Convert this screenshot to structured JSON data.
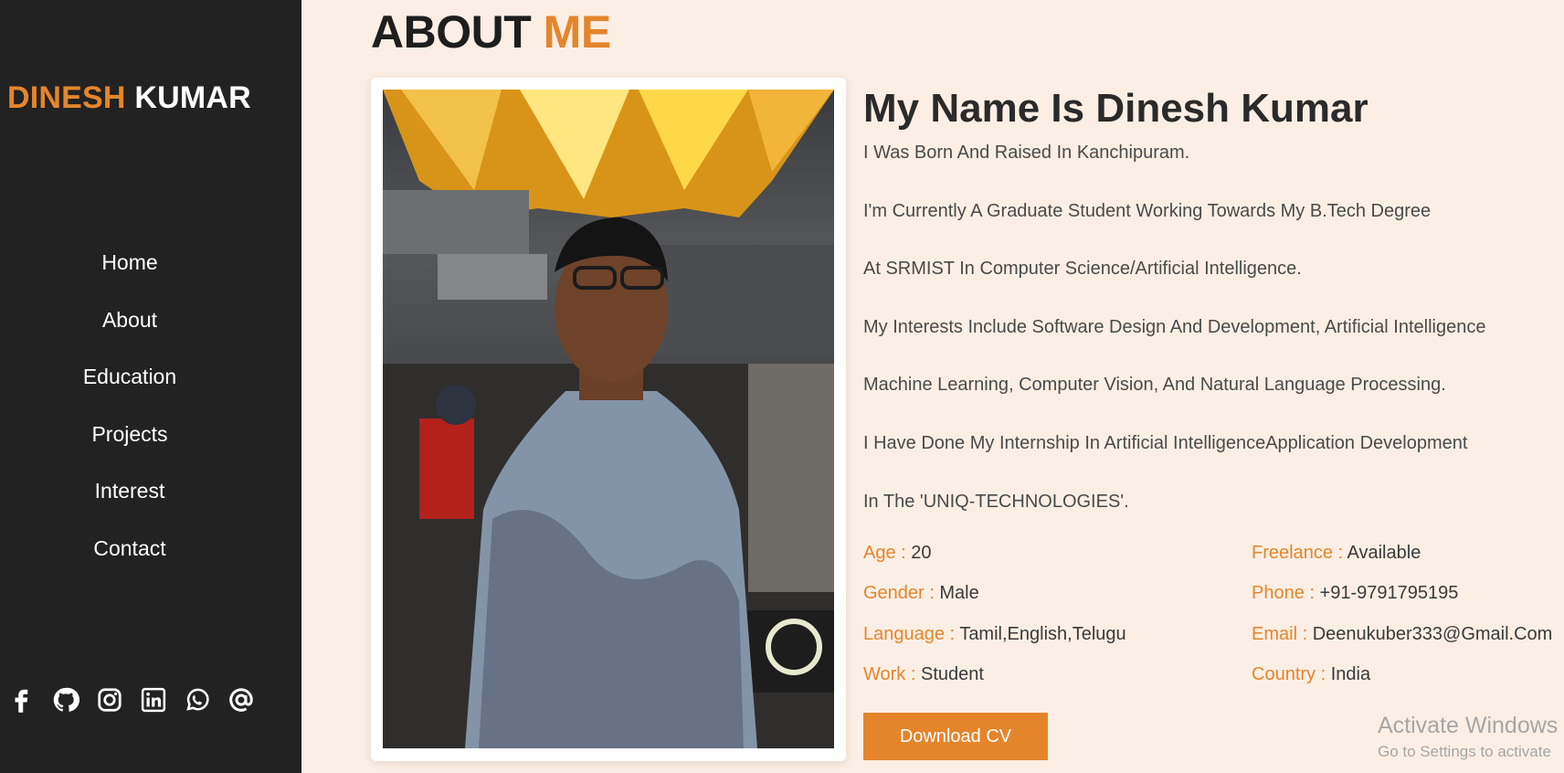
{
  "sidebar": {
    "logo_first": "DINESH",
    "logo_last": "KUMAR",
    "nav": [
      "Home",
      "About",
      "Education",
      "Projects",
      "Interest",
      "Contact"
    ],
    "social_icons": [
      "facebook-icon",
      "github-icon",
      "instagram-icon",
      "linkedin-icon",
      "whatsapp-icon",
      "email-at-icon"
    ]
  },
  "heading": {
    "main": "ABOUT",
    "accent": "ME"
  },
  "about": {
    "name_title": "My Name Is Dinesh Kumar",
    "bio": [
      "I Was Born And Raised In Kanchipuram.",
      "I'm Currently A Graduate Student Working Towards My B.Tech Degree",
      "At SRMIST In Computer Science/Artificial Intelligence.",
      "My Interests Include Software Design And Development, Artificial Intelligence",
      "Machine Learning, Computer Vision, And Natural Language Processing.",
      "I Have Done My Internship In Artificial IntelligenceApplication Development",
      "In The 'UNIQ-TECHNOLOGIES'."
    ],
    "info_left": [
      {
        "label": "Age :",
        "value": "20"
      },
      {
        "label": "Gender :",
        "value": "Male"
      },
      {
        "label": "Language :",
        "value": "Tamil,English,Telugu"
      },
      {
        "label": "Work :",
        "value": "Student"
      }
    ],
    "info_right": [
      {
        "label": "Freelance :",
        "value": "Available"
      },
      {
        "label": "Phone :",
        "value": "+91-9791795195"
      },
      {
        "label": "Email :",
        "value": "Deenukuber333@Gmail.Com"
      },
      {
        "label": "Country :",
        "value": "India"
      }
    ],
    "download_label": "Download CV"
  },
  "watermark": {
    "title": "Activate Windows",
    "subtitle": "Go to Settings to activate"
  },
  "colors": {
    "accent": "#e5852b",
    "sidebar_bg": "#222222",
    "page_bg": "#fbefe5"
  }
}
